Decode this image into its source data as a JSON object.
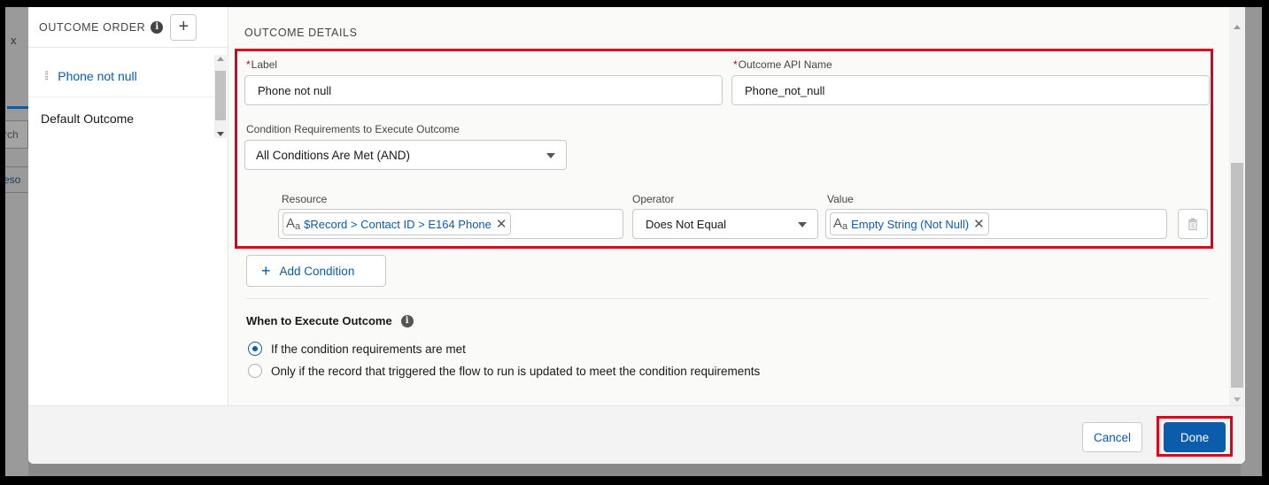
{
  "background": {
    "close_glyph": "x",
    "search_fragment": "rch",
    "resource_fragment": "eso"
  },
  "outcome_order": {
    "title": "OUTCOME ORDER",
    "info_icon": "info-icon",
    "add_glyph": "+",
    "items": [
      {
        "label": "Phone not null",
        "active": true
      },
      {
        "label": "Default Outcome",
        "active": false
      }
    ]
  },
  "details": {
    "title": "OUTCOME DETAILS",
    "label_field": {
      "label": "Label",
      "required_mark": "*",
      "value": "Phone not null"
    },
    "api_name_field": {
      "label": "Outcome API Name",
      "required_mark": "*",
      "value": "Phone_not_null"
    },
    "condition_requirements": {
      "label": "Condition Requirements to Execute Outcome",
      "value": "All Conditions Are Met (AND)"
    },
    "condition": {
      "resource_label": "Resource",
      "resource_value": "$Record > Contact ID > E164 Phone",
      "operator_label": "Operator",
      "operator_value": "Does Not Equal",
      "value_label": "Value",
      "value_value": "Empty String (Not Null)",
      "type_glyph": "A",
      "type_glyph_sub": "a",
      "remove_glyph": "✕"
    },
    "add_condition": {
      "plus": "+",
      "label": "Add Condition"
    },
    "when": {
      "title": "When to Execute Outcome",
      "options": [
        {
          "label": "If the condition requirements are met",
          "checked": true
        },
        {
          "label": "Only if the record that triggered the flow to run is updated to meet the condition requirements",
          "checked": false
        }
      ]
    }
  },
  "footer": {
    "cancel_label": "Cancel",
    "done_label": "Done"
  },
  "colors": {
    "brand": "#0b5cab",
    "highlight": "#e0001b",
    "required": "#ba0517"
  }
}
